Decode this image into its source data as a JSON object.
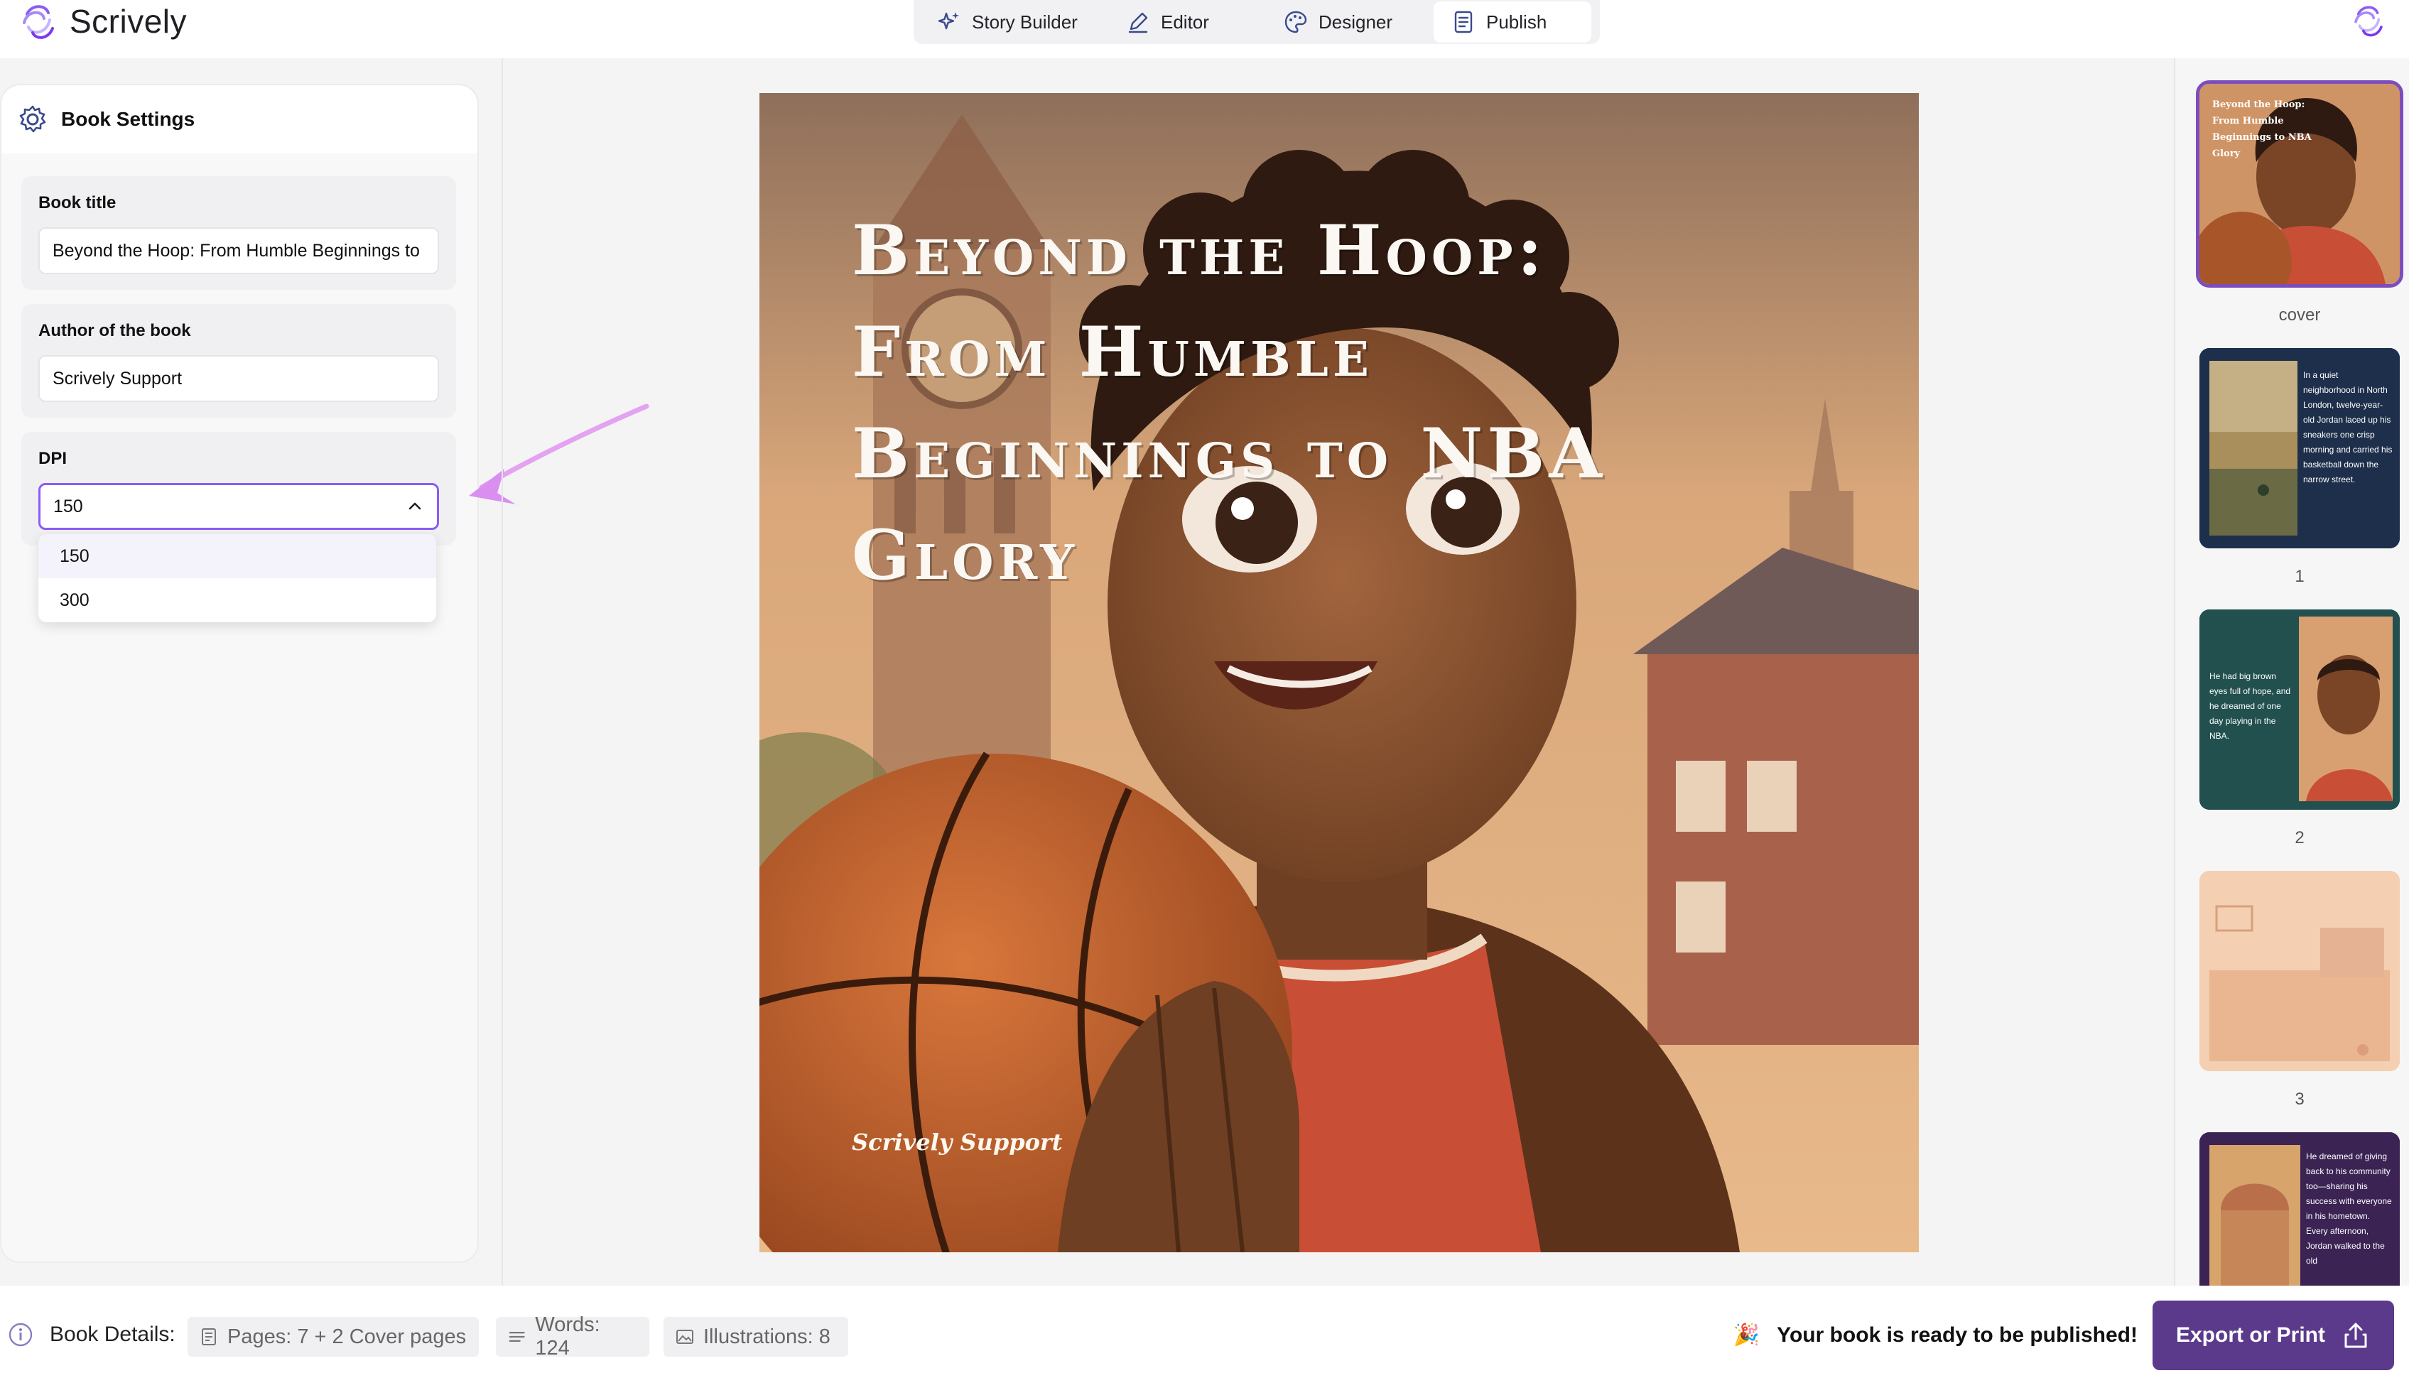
{
  "app": {
    "name": "Scrively",
    "accent": "#8b5cf6",
    "brand_purple": "#5b3a8c"
  },
  "nav": {
    "tabs": [
      {
        "label": "Story Builder",
        "icon": "sparkles-icon"
      },
      {
        "label": "Editor",
        "icon": "pencil-icon"
      },
      {
        "label": "Designer",
        "icon": "palette-icon"
      },
      {
        "label": "Publish",
        "icon": "document-icon",
        "active": true
      }
    ]
  },
  "settings": {
    "title": "Book Settings",
    "book_title_label": "Book title",
    "book_title_value": "Beyond the Hoop: From Humble Beginnings to",
    "author_label": "Author of the book",
    "author_value": "Scrively Support",
    "dpi_label": "DPI",
    "dpi_value": "150",
    "dpi_options": [
      "150",
      "300"
    ]
  },
  "cover": {
    "title_lines": [
      "Beyond the Hoop:",
      "From Humble",
      "Beginnings to NBA",
      "Glory"
    ],
    "author": "Scrively Support"
  },
  "thumbnails": [
    {
      "label": "cover",
      "title_lines": [
        "Beyond the Hoop:",
        "From Humble",
        "Beginnings to NBA",
        "Glory"
      ]
    },
    {
      "label": "1",
      "text": "In a quiet neighborhood in North London, twelve-year-old Jordan laced up his sneakers one crisp morning and carried his basketball down the narrow street."
    },
    {
      "label": "2",
      "text": "He had big brown eyes full of hope, and he dreamed of one day playing in the NBA."
    },
    {
      "label": "3"
    },
    {
      "label": "",
      "text": "He dreamed of giving back to his community too—sharing his success with everyone in his hometown. Every afternoon, Jordan walked to the old"
    }
  ],
  "bottom": {
    "details_label": "Book Details:",
    "pages": "Pages: 7 + 2 Cover pages",
    "words": "Words: 124",
    "illustrations": "Illustrations: 8",
    "ready_message": "Your book is ready to be published!",
    "ready_emoji": "🎉",
    "export_label": "Export or Print"
  }
}
